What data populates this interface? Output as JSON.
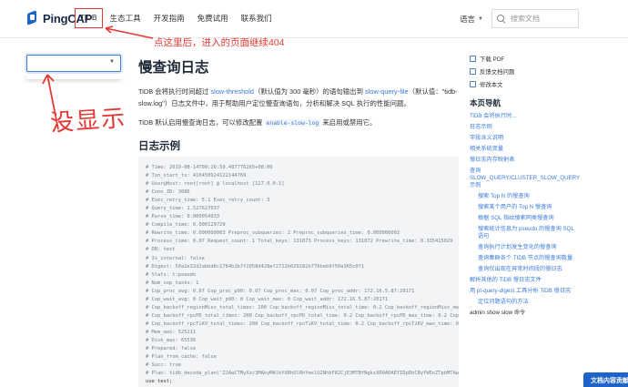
{
  "header": {
    "logo": "PingCAP",
    "nav": [
      "TiDB",
      "生态工具",
      "开发指南",
      "免费试用",
      "联系我们"
    ],
    "language": "语言",
    "search_placeholder": "搜索文档"
  },
  "annotations": {
    "note": "点这里后，进入的页面继续404",
    "handwritten": "没显示"
  },
  "main": {
    "title": "慢查询日志",
    "intro": {
      "p1_a": "TiDB 会将执行时间超过 ",
      "p1_link1": "slow-threshold",
      "p1_b": "（默认值为 300 毫秒）的语句输出到 ",
      "p1_link2": "slow-query-file",
      "p1_c": "（默认值：\"tidb-slow.log\"）日志文件中，用于帮助用户定位慢查询语句，分析和解决 SQL 执行的性能问题。",
      "p2_a": "TiDB 默认启用慢查询日志，可以修改配置 ",
      "p2_code": "enable-slow-log",
      "p2_b": " 来启用或禁用它。"
    },
    "section_title": "日志示例",
    "code_lines": [
      "# Time: 2019-08-14T09:26:59.487776265+08:00",
      "# Txn_start_ts: 410450924122144769",
      "# User@Host: root[root] @ localhost [127.0.0.1]",
      "# Conn_ID: 3086",
      "# Exec_retry_time: 5.1 Exec_retry_count: 3",
      "# Query_time: 1.527627037",
      "# Parse_time: 0.000054933",
      "# Compile_time: 0.000129729",
      "# Rewrite_time: 0.000000003 Preproc_subqueries: 2 Preproc_subqueries_time: 0.000000002",
      "# Process_time: 0.07 Request_count: 1 Total_keys: 131073 Process_keys: 131072 Prewrite_time: 0.335415029",
      "# DB: test",
      "# Is_internal: false",
      "# Digest: 50a2e32d2abbd6c1764b1b7f2058d428ef2712b029282b776beb9f50a365c0f1",
      "# Stats: t:pseudo",
      "# Num_cop_tasks: 1",
      "# Cop_proc_avg: 0.07 Cop_proc_p90: 0.07 Cop_proc_max: 0.07 Cop_proc_addr: 172.16.5.87:20171",
      "# Cop_wait_avg: 0 Cop_wait_p90: 0 Cop_wait_max: 0 Cop_wait_addr: 172.16.5.87:20171",
      "# Cop_backoff_regionMiss_total_times: 200 Cop_backoff_regionMiss_total_time: 0.2 Cop_backoff_regionMiss_max_time",
      "# Cop_backoff_rpcPD_total_times: 200 Cop_backoff_rpcPD_total_time: 0.2 Cop_backoff_rpcPD_max_time: 0.2 Cop_backoff_",
      "# Cop_backoff_rpcTiKV_total_times: 200 Cop_backoff_rpcTiKV_total_time: 0.2 Cop_backoff_rpcTiKV_max_time: 0.2 Cop_b",
      "# Mem_max: 525211",
      "# Disk_max: 65536",
      "# Prepared: false",
      "# Plan_from_cache: false",
      "# Succ: true",
      "# Plan: tidb_decode_plan('ZJAwCTMyXzc3MAkyMAlkYXRhOlRhYmxlU2NhbF82CjE3MTBfNgkxXR0ADAEYIDpDbCByYW5nZTpbMTAwMDAwMDAwMD",
      "use test;",
      "insert into t select * from t;"
    ]
  },
  "toc": {
    "actions": [
      "下载 PDF",
      "反馈文档问题",
      "修改本文"
    ],
    "title": "本页导航",
    "items": [
      {
        "text": "TiDB 会将执行时...",
        "level": 1
      },
      {
        "text": "日志示例",
        "level": 1
      },
      {
        "text": "字段含义说明",
        "level": 1
      },
      {
        "text": "相关系统变量",
        "level": 1
      },
      {
        "text": "慢日志内存映射表",
        "level": 1
      },
      {
        "text": "查询 SLOW_QUERY/CLUSTER_SLOW_QUERY 示例",
        "level": 1
      },
      {
        "text": "搜索 Top N 的慢查询",
        "level": 2
      },
      {
        "text": "搜索某个用户的 Top N 慢查询",
        "level": 2
      },
      {
        "text": "根据 SQL 指纹搜索同类慢查询",
        "level": 2
      },
      {
        "text": "搜索统计信息为 pseudo 的慢查询 SQL 语句",
        "level": 2
      },
      {
        "text": "查询执行计划发生变化的慢查询",
        "level": 2
      },
      {
        "text": "查询集群各个 TIDB 节点的慢查询数量",
        "level": 2
      },
      {
        "text": "查询仅出现在异常时间段的慢日志",
        "level": 2
      },
      {
        "text": "解析其他的 TiDB 慢日志文件",
        "level": 1
      },
      {
        "text": "用 pt-query-digest 工具分析 TiDB 慢日志",
        "level": 1
      },
      {
        "text": "定位问题语句的方法",
        "level": 2
      },
      {
        "text": "admin show slow 命令",
        "level": 1
      }
    ]
  },
  "bottom_button": "文档内容贡献",
  "colors": {
    "accent": "#3b7bd6",
    "annotation": "#e53935",
    "brand": "#1e64c8"
  }
}
